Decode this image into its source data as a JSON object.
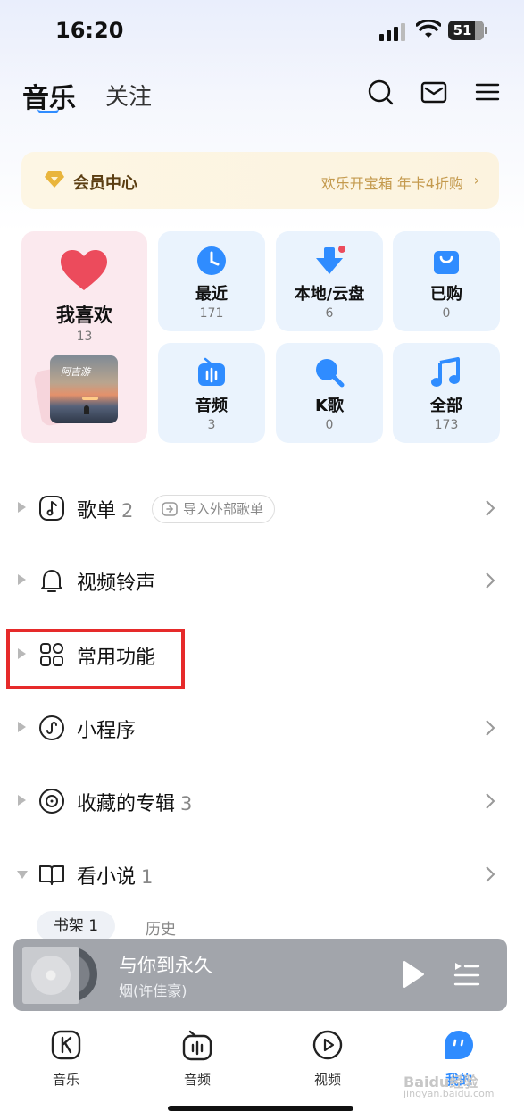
{
  "status_bar": {
    "time": "16:20",
    "battery": "51"
  },
  "header": {
    "tabs": [
      {
        "label": "音乐",
        "active": true
      },
      {
        "label": "关注",
        "active": false
      }
    ],
    "icons": [
      "search-icon",
      "mail-icon",
      "menu-icon"
    ]
  },
  "vip": {
    "title": "会员中心",
    "promo": "欢乐开宝箱 年卡4折购",
    "chevron": "›"
  },
  "favorite": {
    "label": "我喜欢",
    "count": "13",
    "cover_text": "阿吉游"
  },
  "tiles": [
    {
      "label": "最近",
      "count": "171",
      "icon": "clock-icon"
    },
    {
      "label": "本地/云盘",
      "count": "6",
      "icon": "download-icon"
    },
    {
      "label": "已购",
      "count": "0",
      "icon": "shopping-bag-icon"
    },
    {
      "label": "音频",
      "count": "3",
      "icon": "radio-icon"
    },
    {
      "label": "K歌",
      "count": "0",
      "icon": "microphone-icon"
    },
    {
      "label": "全部",
      "count": "173",
      "icon": "music-note-icon"
    }
  ],
  "list": {
    "playlist": {
      "label": "歌单",
      "count": "2",
      "import_label": "导入外部歌单"
    },
    "ringtone": {
      "label": "视频铃声"
    },
    "common": {
      "label": "常用功能"
    },
    "miniapp": {
      "label": "小程序"
    },
    "albums": {
      "label": "收藏的专辑",
      "count": "3"
    },
    "novel": {
      "label": "看小说",
      "count": "1"
    }
  },
  "bookshelf": {
    "shelf_label": "书架 1",
    "history_label": "历史"
  },
  "player": {
    "title": "与你到永久",
    "artist": "烟(许佳豪)"
  },
  "bottom_nav": [
    {
      "label": "音乐",
      "icon": "k-logo-icon"
    },
    {
      "label": "音频",
      "icon": "radio-icon"
    },
    {
      "label": "视频",
      "icon": "video-play-icon"
    },
    {
      "label": "我的",
      "icon": "profile-face-icon",
      "active": true
    }
  ],
  "watermark": {
    "main": "Baidu经验",
    "sub": "jingyan.baidu.com"
  },
  "colors": {
    "accent": "#2f8cff",
    "favorite_bg": "#fbe9ee",
    "tile_bg": "#eaf3fd",
    "vip_text": "#5b3e12",
    "highlight": "#e62a2a"
  }
}
